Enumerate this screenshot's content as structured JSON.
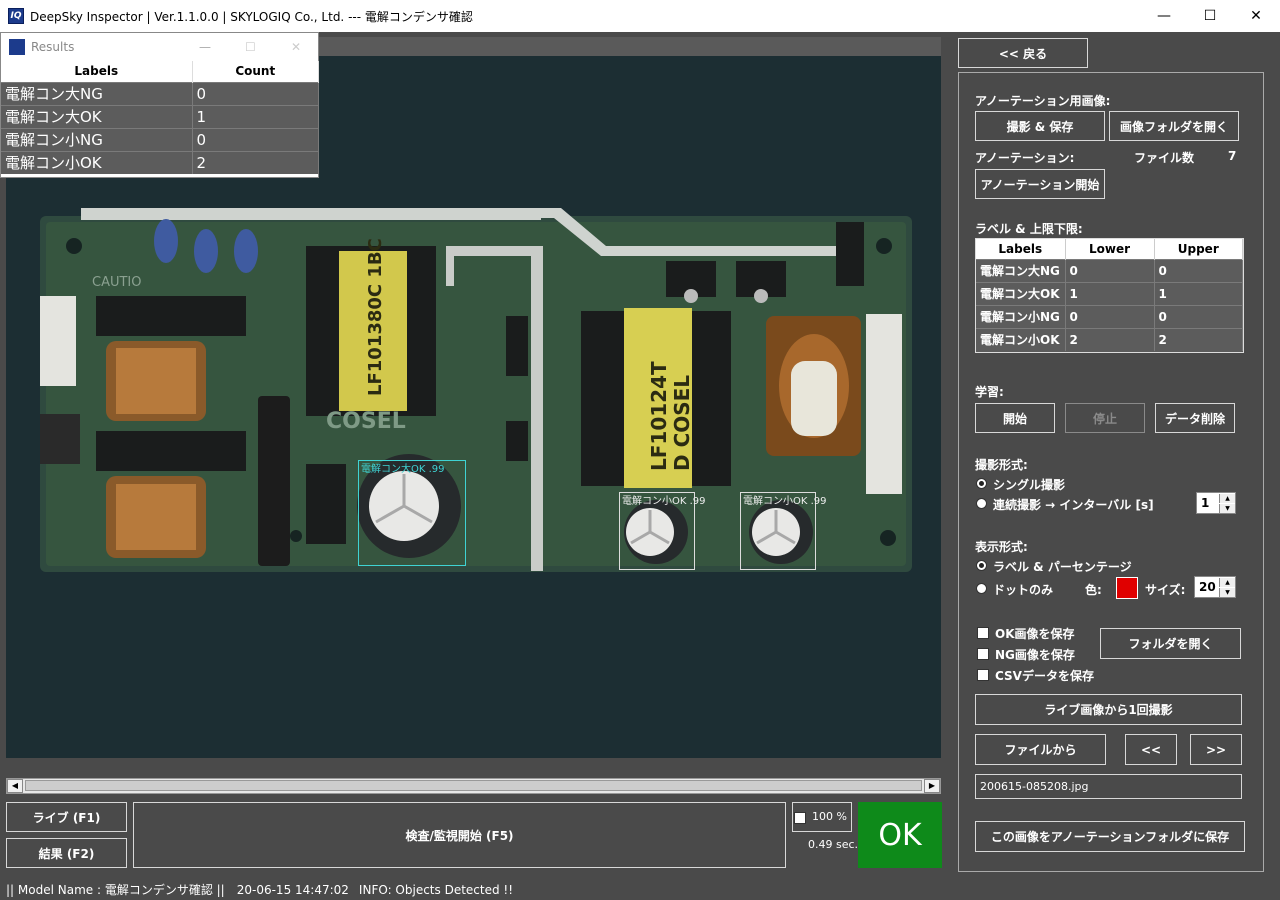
{
  "window": {
    "title": "DeepSky Inspector | Ver.1.1.0.0 | SKYLOGIQ Co., Ltd. --- 電解コンデンサ確認",
    "app_icon": "IQ"
  },
  "results_window": {
    "title": "Results",
    "columns": [
      "Labels",
      "Count"
    ],
    "rows": [
      {
        "label": "電解コン大NG",
        "count": "0"
      },
      {
        "label": "電解コン大OK",
        "count": "1"
      },
      {
        "label": "電解コン小NG",
        "count": "0"
      },
      {
        "label": "電解コン小OK",
        "count": "2"
      }
    ]
  },
  "viewer": {
    "pcb_text": {
      "transformer1": "LF101380C 1BC",
      "transformer2_line1": "LF10124T",
      "transformer2_line2": "D COSEL",
      "brand": "COSEL",
      "caution": "CAUTIO"
    },
    "detections": [
      {
        "label": "電解コン大OK .99"
      },
      {
        "label": "電解コン小OK .99"
      },
      {
        "label": "電解コン小OK .99"
      }
    ]
  },
  "right_panel": {
    "back_button": "<< 戻る",
    "annotation_images_label": "アノーテーション用画像:",
    "capture_save_button": "撮影 & 保存",
    "open_image_folder_button": "画像フォルダを開く",
    "annotation_label": "アノーテーション:",
    "file_count_label": "ファイル数",
    "file_count_value": "7",
    "start_annotation_button": "アノーテーション開始",
    "label_limits_label": "ラベル & 上限下限:",
    "limits_table": {
      "columns": [
        "Labels",
        "Lower",
        "Upper"
      ],
      "rows": [
        {
          "label": "電解コン大NG",
          "lower": "0",
          "upper": "0"
        },
        {
          "label": "電解コン大OK",
          "lower": "1",
          "upper": "1"
        },
        {
          "label": "電解コン小NG",
          "lower": "0",
          "upper": "0"
        },
        {
          "label": "電解コン小OK",
          "lower": "2",
          "upper": "2"
        }
      ]
    },
    "learning_label": "学習:",
    "start_button": "開始",
    "stop_button": "停止",
    "delete_data_button": "データ削除",
    "capture_mode_label": "撮影形式:",
    "single_capture_option": "シングル撮影",
    "continuous_capture_option": "連続撮影 → インターバル [s]",
    "interval_value": "1",
    "display_mode_label": "表示形式:",
    "label_percent_option": "ラベル & パーセンテージ",
    "dot_only_option": "ドットのみ",
    "color_label": "色:",
    "dot_color": "#e00000",
    "size_label": "サイズ:",
    "size_value": "20",
    "save_ok_images": "OK画像を保存",
    "save_ng_images": "NG画像を保存",
    "save_csv": "CSVデータを保存",
    "open_folder_button": "フォルダを開く",
    "live_capture_button": "ライブ画像から1回撮影",
    "from_file_button": "ファイルから",
    "prev_button": "<<",
    "next_button": ">>",
    "filename": "200615-085208.jpg",
    "save_to_annotation_button": "この画像をアノーテーションフォルダに保存"
  },
  "bottom": {
    "live_button": "ライブ (F1)",
    "results_button": "結果 (F2)",
    "inspect_button": "検査/監視開始 (F5)",
    "zoom_text": "100 %",
    "elapsed": "0.49 sec.",
    "verdict": "OK",
    "verdict_color": "#0e8a1a"
  },
  "status": {
    "model_name": "|| Model Name : 電解コンデンサ確認 ||",
    "timestamp": "20-06-15 14:47:02",
    "info": "INFO:   Objects Detected !!"
  }
}
